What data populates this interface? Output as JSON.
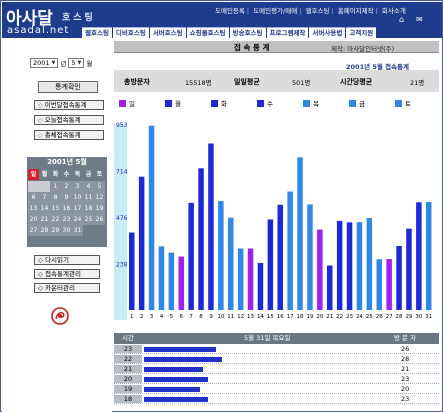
{
  "header": {
    "logo_main": "아사달",
    "logo_sub": "호스팅",
    "logo_domain": "asadal.net",
    "top_links": [
      "도메인등록",
      "도메인평가/매매",
      "웹호스팅",
      "홈페이지제작",
      "회사소개"
    ],
    "nav_tabs": [
      "웹호스팅",
      "디비호스팅",
      "서버호스팅",
      "쇼핑몰호스팅",
      "방송호스팅",
      "프로그램제작",
      "서버사용법",
      "고객지원"
    ],
    "icons": [
      "home-icon",
      "cart-icon"
    ]
  },
  "left_panel": {
    "year": "2001",
    "year_unit": "년",
    "month": "5",
    "month_unit": "월",
    "check_button": "통계확인",
    "menu": [
      "이번달접속통계",
      "오늘접속통계",
      "총체접속통계"
    ],
    "calendar": {
      "title": "2001년 5월",
      "weekdays": [
        "일",
        "월",
        "화",
        "수",
        "목",
        "금",
        "토"
      ],
      "leading_blanks": 2,
      "days": [
        "1",
        "2",
        "3",
        "4",
        "5",
        "6",
        "7",
        "8",
        "9",
        "10",
        "11",
        "12",
        "13",
        "14",
        "15",
        "16",
        "17",
        "18",
        "19",
        "20",
        "21",
        "22",
        "23",
        "24",
        "25",
        "26",
        "27",
        "28",
        "29",
        "30",
        "31"
      ]
    },
    "tools": [
      "다시읽기",
      "접속통계관리",
      "카운터관리"
    ]
  },
  "main": {
    "title": "접 속 통 계",
    "maker": "제작: 아사달인터넷(주)",
    "period": "2001년 5월 접속통계",
    "stats": {
      "total_label": "총방문자",
      "total_value": "15518명",
      "daily_label": "일일평균",
      "daily_value": "501명",
      "hourly_label": "시간당평균",
      "hourly_value": "21명"
    },
    "legend": [
      "일",
      "월",
      "화",
      "수",
      "목",
      "금",
      "토"
    ],
    "table": {
      "headers": [
        "시간",
        "5월 31일 목요일",
        "방 문 자"
      ],
      "rows": [
        {
          "hour": "23",
          "count": 26
        },
        {
          "hour": "22",
          "count": 28
        },
        {
          "hour": "21",
          "count": 21
        },
        {
          "hour": "20",
          "count": 23
        },
        {
          "hour": "19",
          "count": 20
        },
        {
          "hour": "18",
          "count": 23
        }
      ]
    }
  },
  "colors": {
    "header_bg": "#1f3c8c",
    "sunday": "#a020f0",
    "monday": "#1c2ad6",
    "tuesday": "#1c2ad6",
    "wednesday": "#1c2ad6",
    "thursday": "#2f88e6",
    "friday": "#2f88e6",
    "saturday": "#2f88e6"
  },
  "chart_data": {
    "type": "bar",
    "title": "",
    "categories": [
      "1",
      "2",
      "3",
      "4",
      "5",
      "6",
      "7",
      "8",
      "9",
      "10",
      "11",
      "12",
      "13",
      "14",
      "15",
      "16",
      "17",
      "18",
      "19",
      "20",
      "21",
      "22",
      "23",
      "24",
      "25",
      "26",
      "27",
      "28",
      "29",
      "30",
      "31"
    ],
    "weekday_index": [
      2,
      3,
      4,
      5,
      6,
      0,
      1,
      2,
      3,
      4,
      5,
      6,
      0,
      1,
      2,
      3,
      4,
      5,
      6,
      0,
      1,
      2,
      3,
      4,
      5,
      6,
      0,
      1,
      2,
      3,
      4
    ],
    "values": [
      397,
      683,
      944,
      326,
      294,
      274,
      549,
      726,
      853,
      558,
      473,
      315,
      315,
      241,
      464,
      539,
      607,
      782,
      541,
      412,
      228,
      456,
      449,
      450,
      471,
      260,
      261,
      328,
      417,
      552,
      553
    ],
    "y_ticks": [
      238,
      476,
      714,
      953
    ],
    "ylim": [
      0,
      953
    ]
  }
}
